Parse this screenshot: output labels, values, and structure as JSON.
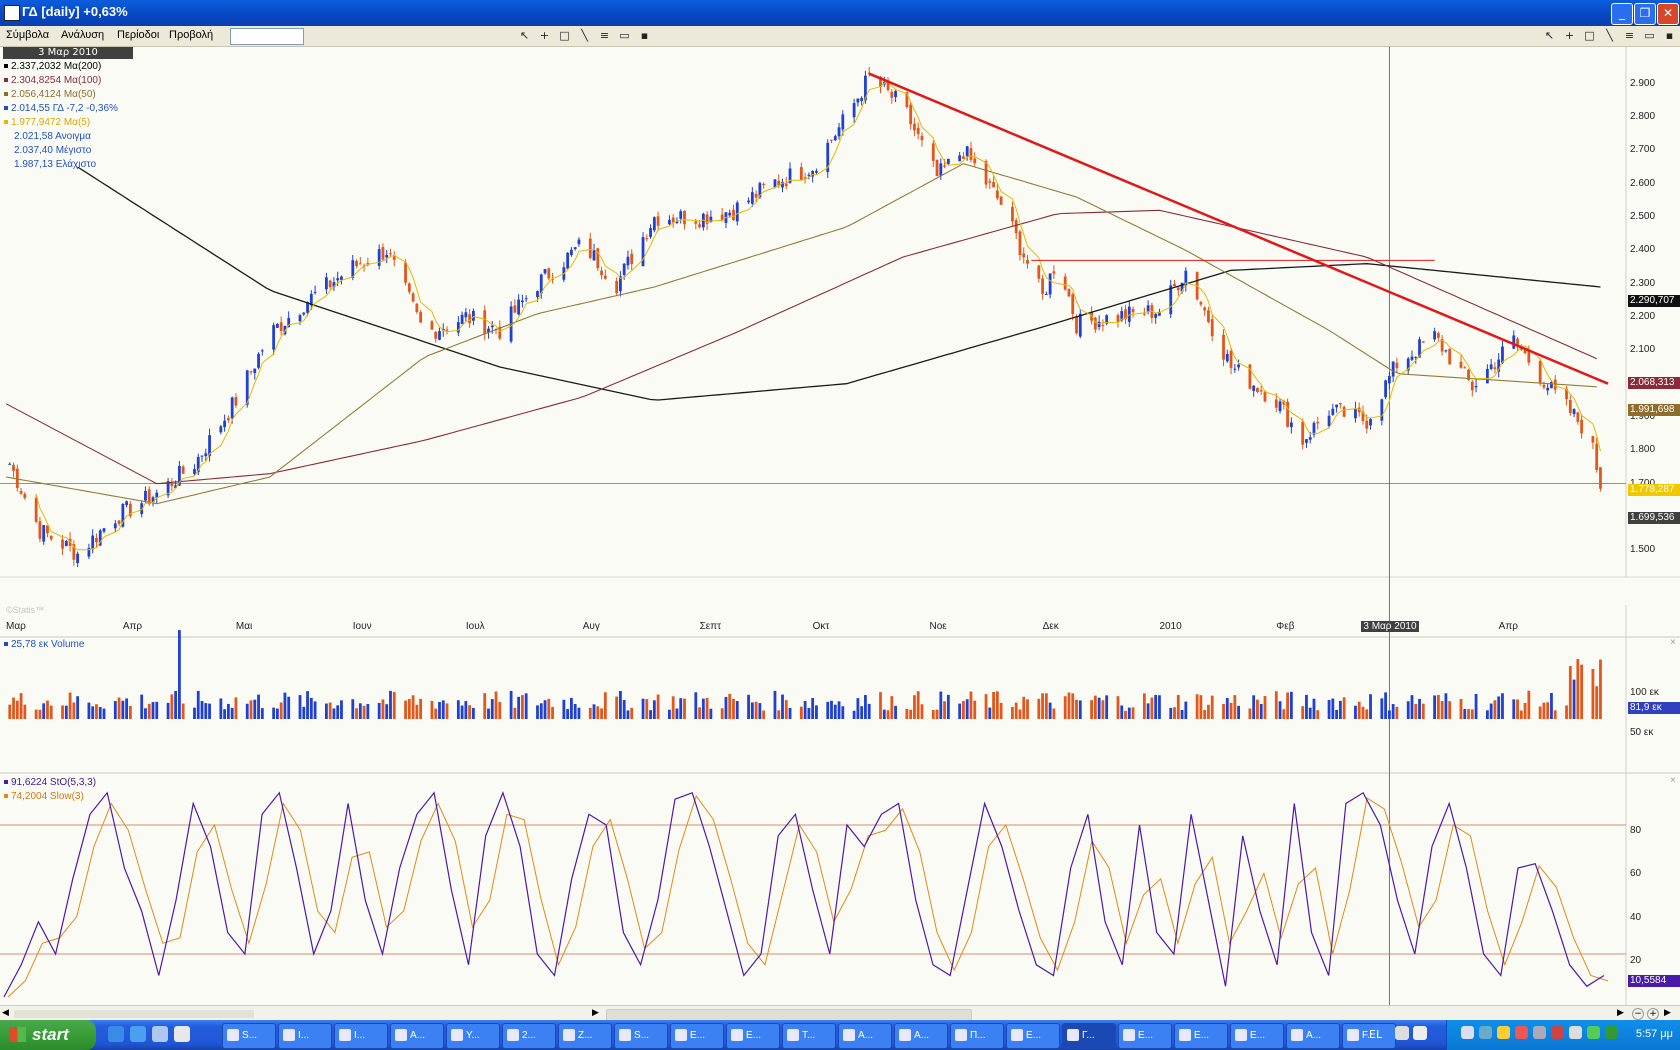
{
  "window": {
    "title": "ΓΔ [daily] +0,63%"
  },
  "menu": [
    "Σύμβολα",
    "Ανάλυση",
    "Περίοδοι",
    "Προβολή"
  ],
  "colors": {
    "up": "#2040d0",
    "down": "#e0581e",
    "ma200": "#1a1a1a",
    "ma100": "#8a2a3a",
    "ma50": "#8f7d3c",
    "ma5": "#e6b800",
    "trend": "#e01818",
    "stoch": "#4a1aa8",
    "slow": "#e08a18"
  },
  "price_panel": {
    "date_label": "3 Μαρ 2010",
    "legend": [
      {
        "text": "2.337,2032 Μα(200)",
        "color": "#000000"
      },
      {
        "text": "2.304,8254 Μα(100)",
        "color": "#8a2a3a"
      },
      {
        "text": "2.056,4124 Μα(50)",
        "color": "#8f6d2c"
      },
      {
        "text": "2.014,55 ΓΔ -7,2 -0,36%",
        "color": "#2050c0"
      },
      {
        "text": "1.977,9472 Μα(5)",
        "color": "#d8a800"
      },
      {
        "text": "2.021,58 Ανοιγμα",
        "color": "#2050c0"
      },
      {
        "text": "2.037,40 Μέγιστο",
        "color": "#2050c0"
      },
      {
        "text": "1.987,13 Ελάχιστο",
        "color": "#2050c0"
      }
    ],
    "y_ticks": [
      "2.900",
      "2.800",
      "2.700",
      "2.600",
      "2.500",
      "2.400",
      "2.300",
      "2.200",
      "2.100",
      "2.000",
      "1.900",
      "1.800",
      "1.700",
      "1.600",
      "1.500"
    ],
    "price_tags": [
      {
        "text": "2.290,707",
        "bg": "#111111",
        "fg": "#ffffff"
      },
      {
        "text": "2.068,313",
        "bg": "#8a2a3a",
        "fg": "#ffffff"
      },
      {
        "text": "1.991,698",
        "bg": "#8f6d2c",
        "fg": "#ffffff"
      },
      {
        "text": "1.778,287",
        "bg": "#f0c800",
        "fg": "#ffffff"
      },
      {
        "text": "1.699,536",
        "bg": "#404040",
        "fg": "#ffffff"
      }
    ],
    "x_ticks": [
      "Μαρ",
      "Απρ",
      "Μαι",
      "Ιουν",
      "Ιουλ",
      "Αυγ",
      "Σεπτ",
      "Οκτ",
      "Νοε",
      "Δεκ",
      "2010",
      "Φεβ",
      "3 Μαρ 2010",
      "Απρ"
    ],
    "watermark": "©Statis™"
  },
  "volume_panel": {
    "legend": "25,78 εκ Volume",
    "y_ticks": [
      "100 εκ",
      "50 εκ"
    ],
    "tag": "81,9 εκ"
  },
  "stoch_panel": {
    "legend1": "91,6224 StO(5,3,3)",
    "legend2": "74,2004 Slow(3)",
    "y_ticks": [
      "80",
      "60",
      "40",
      "20"
    ],
    "tag": "10,5584"
  },
  "taskbar": {
    "start": "start",
    "buttons": [
      "S...",
      "I...",
      "I...",
      "A...",
      "Y...",
      "2...",
      "Z...",
      "S...",
      "E...",
      "E...",
      "T...",
      "A...",
      "A...",
      "Π...",
      "E...",
      "Γ...",
      "E...",
      "E...",
      "E...",
      "A...",
      "F..."
    ],
    "lang": "EL",
    "clock": "5:57 μμ"
  },
  "chart_data": {
    "type": "candlestick",
    "title": "ΓΔ [daily] +0,63%",
    "x_range": [
      "2009-03-01",
      "2010-04-30"
    ],
    "ylim": [
      1450,
      2950
    ],
    "close_points": [
      [
        "2009-03-02",
        1760
      ],
      [
        "2009-03-10",
        1560
      ],
      [
        "2009-03-20",
        1490
      ],
      [
        "2009-03-30",
        1600
      ],
      [
        "2009-04-10",
        1670
      ],
      [
        "2009-04-20",
        1760
      ],
      [
        "2009-05-01",
        1950
      ],
      [
        "2009-05-10",
        2150
      ],
      [
        "2009-05-20",
        2250
      ],
      [
        "2009-06-01",
        2350
      ],
      [
        "2009-06-10",
        2400
      ],
      [
        "2009-06-20",
        2150
      ],
      [
        "2009-07-01",
        2200
      ],
      [
        "2009-07-10",
        2160
      ],
      [
        "2009-07-20",
        2300
      ],
      [
        "2009-08-01",
        2420
      ],
      [
        "2009-08-10",
        2300
      ],
      [
        "2009-08-20",
        2500
      ],
      [
        "2009-09-01",
        2500
      ],
      [
        "2009-09-10",
        2520
      ],
      [
        "2009-09-20",
        2600
      ],
      [
        "2009-10-01",
        2650
      ],
      [
        "2009-10-10",
        2800
      ],
      [
        "2009-10-16",
        2920
      ],
      [
        "2009-10-25",
        2830
      ],
      [
        "2009-11-03",
        2620
      ],
      [
        "2009-11-10",
        2700
      ],
      [
        "2009-11-20",
        2540
      ],
      [
        "2009-12-01",
        2260
      ],
      [
        "2009-12-05",
        2380
      ],
      [
        "2009-12-10",
        2180
      ],
      [
        "2009-12-20",
        2200
      ],
      [
        "2010-01-01",
        2220
      ],
      [
        "2010-01-08",
        2340
      ],
      [
        "2010-01-20",
        2050
      ],
      [
        "2010-02-01",
        1950
      ],
      [
        "2010-02-08",
        1830
      ],
      [
        "2010-02-15",
        1920
      ],
      [
        "2010-02-25",
        1890
      ],
      [
        "2010-03-05",
        2060
      ],
      [
        "2010-03-15",
        2140
      ],
      [
        "2010-03-25",
        1990
      ],
      [
        "2010-04-05",
        2130
      ],
      [
        "2010-04-15",
        1980
      ],
      [
        "2010-04-25",
        1850
      ],
      [
        "2010-04-28",
        1700
      ]
    ],
    "ma200_points": [
      [
        "2009-03-20",
        2650
      ],
      [
        "2009-05-10",
        2280
      ],
      [
        "2009-07-10",
        2050
      ],
      [
        "2009-08-20",
        1950
      ],
      [
        "2009-10-10",
        2000
      ],
      [
        "2009-12-01",
        2170
      ],
      [
        "2010-01-20",
        2340
      ],
      [
        "2010-02-25",
        2360
      ],
      [
        "2010-04-28",
        2290
      ]
    ],
    "ma100_points": [
      [
        "2009-03-01",
        1940
      ],
      [
        "2009-04-10",
        1700
      ],
      [
        "2009-05-10",
        1730
      ],
      [
        "2009-06-20",
        1830
      ],
      [
        "2009-08-01",
        1960
      ],
      [
        "2009-09-10",
        2150
      ],
      [
        "2009-10-25",
        2380
      ],
      [
        "2009-12-05",
        2510
      ],
      [
        "2010-01-01",
        2520
      ],
      [
        "2010-02-25",
        2380
      ],
      [
        "2010-04-28",
        2070
      ]
    ],
    "ma50_points": [
      [
        "2009-03-01",
        1720
      ],
      [
        "2009-04-10",
        1640
      ],
      [
        "2009-05-10",
        1720
      ],
      [
        "2009-06-20",
        2080
      ],
      [
        "2009-07-20",
        2210
      ],
      [
        "2009-08-20",
        2290
      ],
      [
        "2009-10-10",
        2470
      ],
      [
        "2009-11-10",
        2660
      ],
      [
        "2009-12-10",
        2560
      ],
      [
        "2010-01-08",
        2400
      ],
      [
        "2010-02-15",
        2160
      ],
      [
        "2010-03-05",
        2030
      ],
      [
        "2010-04-28",
        1990
      ]
    ],
    "trendline": [
      [
        "2009-10-16",
        2930
      ],
      [
        "2010-04-30",
        2000
      ]
    ],
    "resistance_line": {
      "y": 2370,
      "from": "2009-11-28",
      "to": "2010-03-15"
    },
    "cursor_date": "2010-03-03",
    "volume_ylim": [
      0,
      120
    ],
    "stoch_ylim": [
      0,
      100
    ],
    "stoch_levels": [
      20,
      80
    ],
    "stoch_points": [
      0,
      15,
      35,
      20,
      55,
      85,
      95,
      60,
      40,
      10,
      45,
      90,
      70,
      30,
      20,
      85,
      95,
      60,
      20,
      40,
      90,
      45,
      20,
      60,
      85,
      95,
      50,
      15,
      75,
      95,
      70,
      20,
      10,
      55,
      85,
      80,
      30,
      15,
      45,
      92,
      95,
      70,
      40,
      10,
      20,
      75,
      85,
      50,
      20,
      80,
      70,
      85,
      90,
      45,
      15,
      10,
      50,
      90,
      70,
      40,
      15,
      10,
      60,
      85,
      35,
      15,
      80,
      30,
      20,
      85,
      45,
      5,
      75,
      40,
      15,
      90,
      30,
      10,
      90,
      95,
      80,
      45,
      20,
      70,
      90,
      60,
      20,
      10,
      60,
      62,
      40,
      15,
      5,
      10
    ]
  }
}
